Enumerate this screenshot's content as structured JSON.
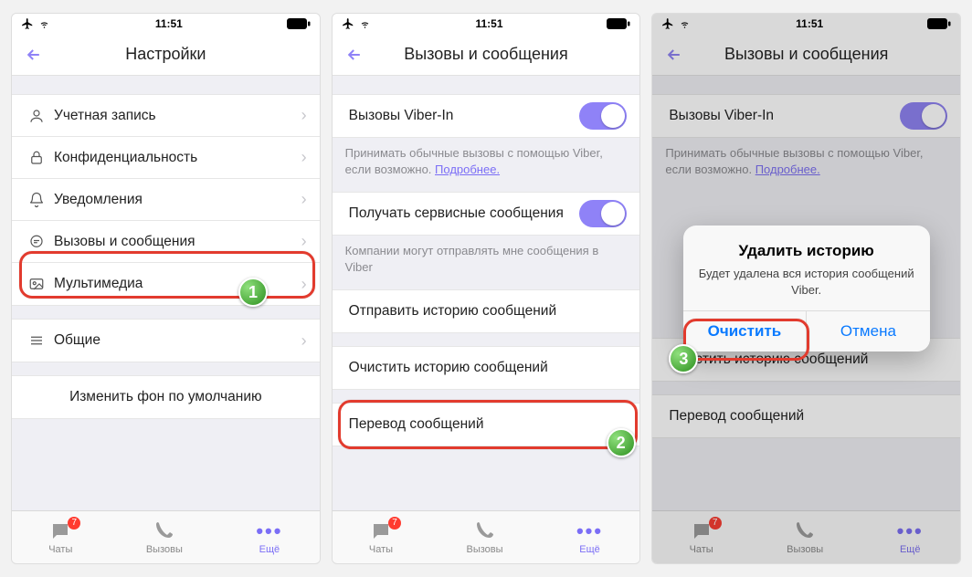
{
  "status": {
    "time": "11:51"
  },
  "accent": "#7b6ef6",
  "panel1": {
    "title": "Настройки",
    "items": {
      "account": "Учетная запись",
      "privacy": "Конфиденциальность",
      "notifications": "Уведомления",
      "calls_msgs": "Вызовы и сообщения",
      "media": "Мультимедиа",
      "general": "Общие",
      "change_bg": "Изменить фон по умолчанию"
    },
    "step_badge": "1"
  },
  "panel2": {
    "title": "Вызовы и сообщения",
    "viber_in_label": "Вызовы Viber-In",
    "viber_in_desc_a": "Принимать обычные вызовы с помощью Viber, если возможно. ",
    "viber_in_more": "Подробнее.",
    "service_label": "Получать сервисные сообщения",
    "service_desc": "Компании могут отправлять мне сообщения в Viber",
    "send_history": "Отправить историю сообщений",
    "clear_history": "Очистить историю сообщений",
    "translate": "Перевод сообщений",
    "step_badge": "2"
  },
  "panel3": {
    "title": "Вызовы и сообщения",
    "viber_in_label": "Вызовы Viber-In",
    "viber_in_desc_a": "Принимать обычные вызовы с помощью Viber, если возможно. ",
    "viber_in_more": "Подробнее.",
    "clear_history": "Очистить историю сообщений",
    "translate": "Перевод сообщений",
    "alert": {
      "title": "Удалить историю",
      "message": "Будет удалена вся история сообщений Viber.",
      "confirm": "Очистить",
      "cancel": "Отмена"
    },
    "step_badge": "3"
  },
  "tabs": {
    "chats": "Чаты",
    "calls": "Вызовы",
    "more": "Ещё",
    "chats_badge": "7"
  }
}
